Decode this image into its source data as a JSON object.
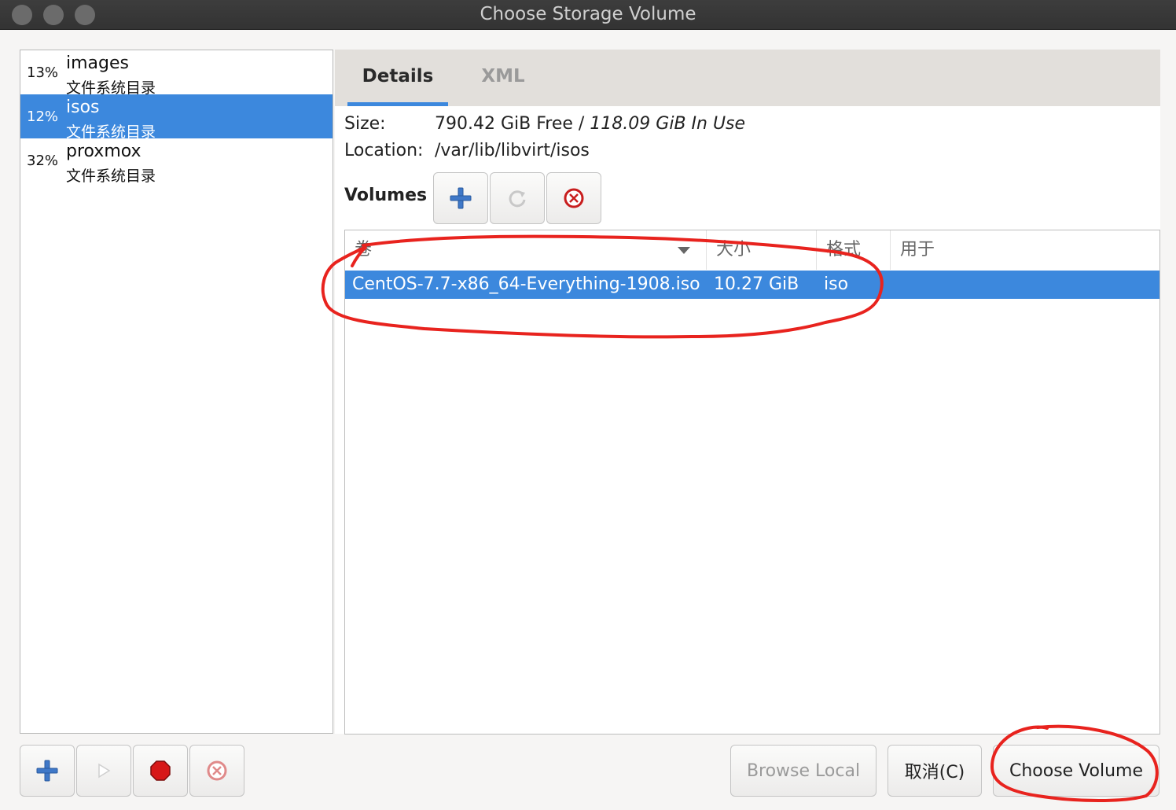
{
  "window": {
    "title": "Choose Storage Volume"
  },
  "pools": [
    {
      "usage": "13%",
      "name": "images",
      "type": "文件系统目录",
      "selected": false
    },
    {
      "usage": "12%",
      "name": "isos",
      "type": "文件系统目录",
      "selected": true
    },
    {
      "usage": "32%",
      "name": "proxmox",
      "type": "文件系统目录",
      "selected": false
    }
  ],
  "tabs": {
    "details": "Details",
    "xml": "XML"
  },
  "details": {
    "size_label": "Size:",
    "size_free": "790.42 GiB Free",
    "size_sep": " / ",
    "size_inuse": "118.09 GiB In Use",
    "location_label": "Location:",
    "location_value": "/var/lib/libvirt/isos",
    "volumes_label": "Volumes"
  },
  "volume_table": {
    "columns": [
      "卷",
      "大小",
      "格式",
      "用于"
    ],
    "rows": [
      {
        "name": "CentOS-7.7-x86_64-Everything-1908.iso",
        "size": "10.27 GiB",
        "format": "iso",
        "used_by": ""
      }
    ]
  },
  "buttons": {
    "browse_local": "Browse Local",
    "cancel": "取消(C)",
    "choose_volume": "Choose Volume"
  },
  "colors": {
    "selection": "#3c88dd",
    "annotation": "#e8231e"
  }
}
